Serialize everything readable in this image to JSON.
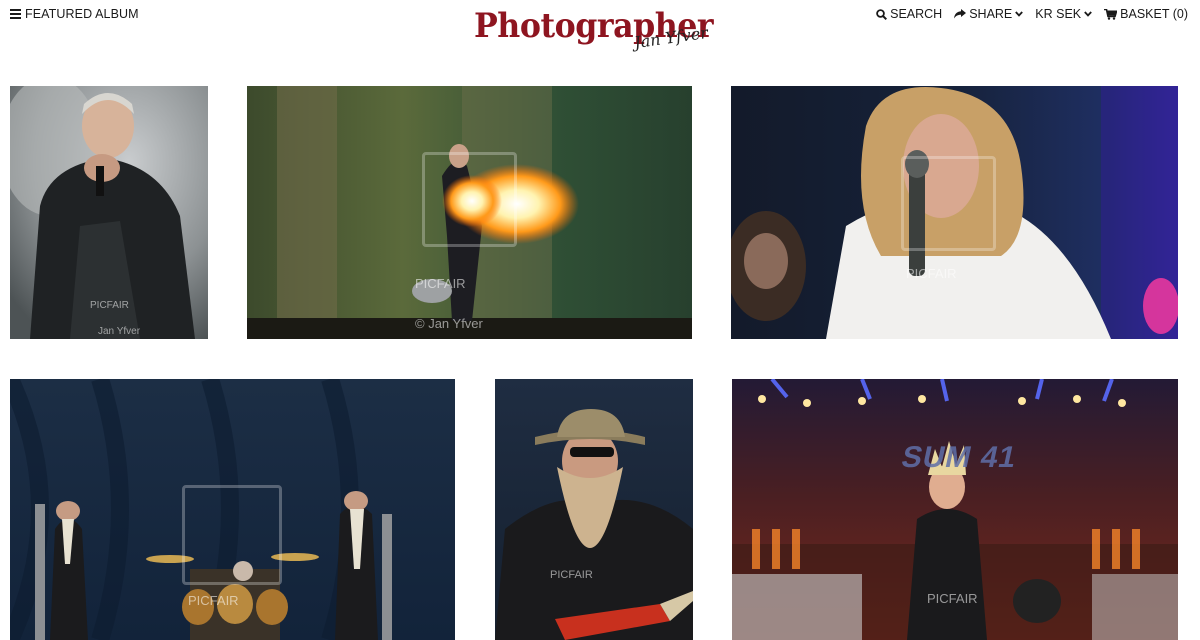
{
  "header": {
    "featured_label": "FEATURED ALBUM",
    "logo_main": "Photographer",
    "logo_sub": "Jan Yfver",
    "search_label": "SEARCH",
    "share_label": "SHARE",
    "currency_label": "KR SEK",
    "basket_label": "BASKET (0)"
  },
  "photos": [
    {
      "watermark": "PICFAIR",
      "credit": "Jan Yfver"
    },
    {
      "watermark": "PICFAIR",
      "credit": "© Jan Yfver"
    },
    {
      "watermark": "PICFAIR",
      "credit": ""
    },
    {
      "watermark": "PICFAIR",
      "credit": ""
    },
    {
      "watermark": "PICFAIR",
      "credit": ""
    },
    {
      "watermark": "PICFAIR",
      "credit": "",
      "banner": "SUM 41"
    }
  ],
  "icons": {
    "menu": "hamburger-icon",
    "search": "search-icon",
    "share": "share-icon",
    "chevron": "chevron-down-icon",
    "basket": "basket-icon"
  },
  "colors": {
    "logo": "#8e1520",
    "text": "#1a1a1a",
    "background": "#ffffff"
  }
}
